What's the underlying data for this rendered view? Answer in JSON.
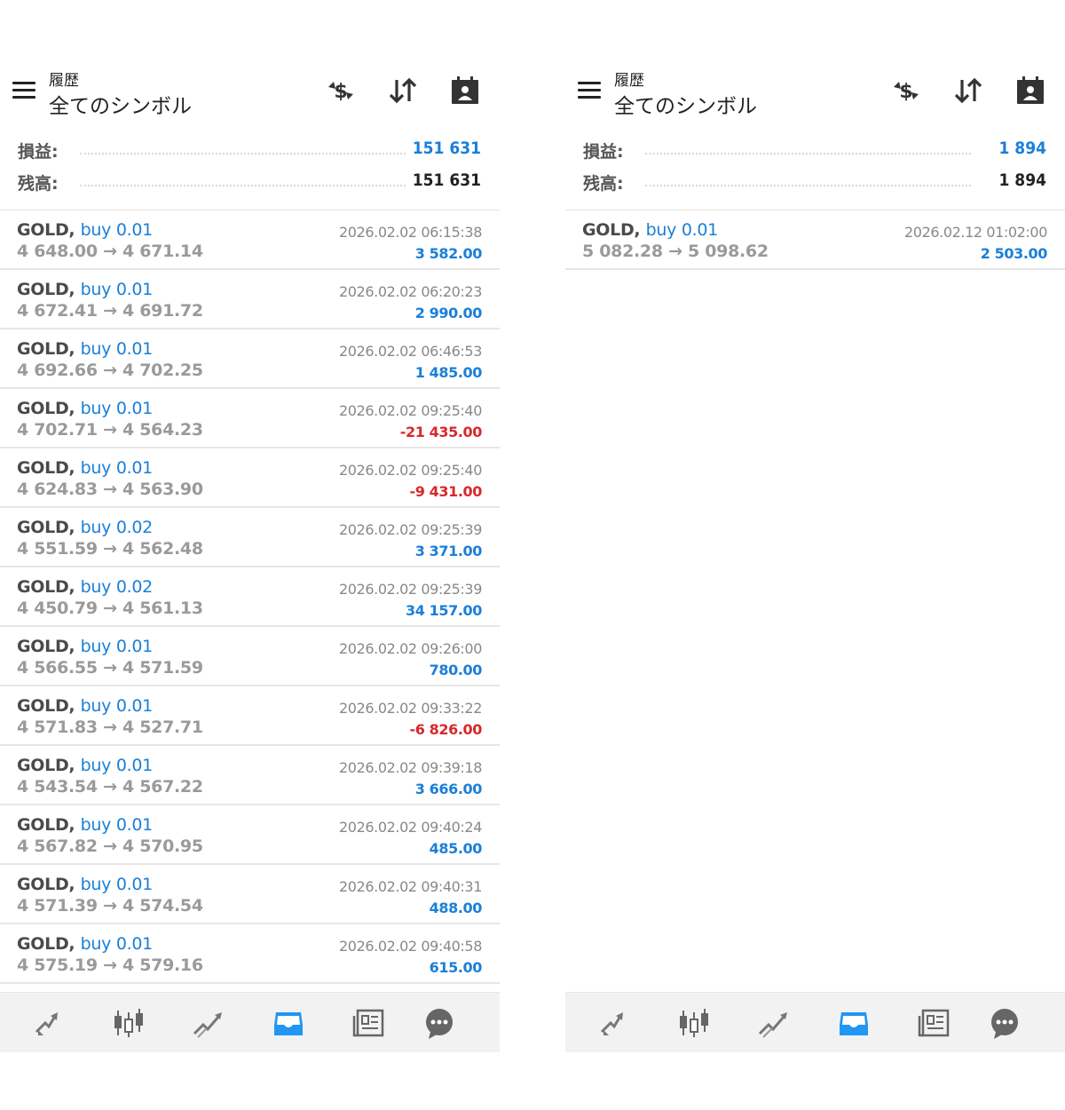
{
  "colors": {
    "accent_blue": "#1a7fd8",
    "loss_red": "#d8282b",
    "nav_bg": "#f2f2f2"
  },
  "icons": {
    "header": [
      "menu-icon",
      "currency-exchange-icon",
      "sort-icon",
      "calendar-icon"
    ],
    "nav": [
      "trade-icon",
      "candles-icon",
      "chart-icon",
      "history-inbox-icon",
      "news-icon",
      "chat-icon"
    ]
  },
  "left": {
    "header": {
      "small": "履歴",
      "title": "全てのシンボル"
    },
    "summary": {
      "profit_label": "損益:",
      "profit_value": "151 631",
      "balance_label": "残高:",
      "balance_value": "151 631"
    },
    "rows": [
      {
        "symbol": "GOLD,",
        "type": "buy 0.01",
        "prices": "4 648.00 → 4 671.14",
        "time": "2026.02.02 06:15:38",
        "profit": "3 582.00",
        "negative": false
      },
      {
        "symbol": "GOLD,",
        "type": "buy 0.01",
        "prices": "4 672.41 → 4 691.72",
        "time": "2026.02.02 06:20:23",
        "profit": "2 990.00",
        "negative": false
      },
      {
        "symbol": "GOLD,",
        "type": "buy 0.01",
        "prices": "4 692.66 → 4 702.25",
        "time": "2026.02.02 06:46:53",
        "profit": "1 485.00",
        "negative": false
      },
      {
        "symbol": "GOLD,",
        "type": "buy 0.01",
        "prices": "4 702.71 → 4 564.23",
        "time": "2026.02.02 09:25:40",
        "profit": "-21 435.00",
        "negative": true
      },
      {
        "symbol": "GOLD,",
        "type": "buy 0.01",
        "prices": "4 624.83 → 4 563.90",
        "time": "2026.02.02 09:25:40",
        "profit": "-9 431.00",
        "negative": true
      },
      {
        "symbol": "GOLD,",
        "type": "buy 0.02",
        "prices": "4 551.59 → 4 562.48",
        "time": "2026.02.02 09:25:39",
        "profit": "3 371.00",
        "negative": false
      },
      {
        "symbol": "GOLD,",
        "type": "buy 0.02",
        "prices": "4 450.79 → 4 561.13",
        "time": "2026.02.02 09:25:39",
        "profit": "34 157.00",
        "negative": false
      },
      {
        "symbol": "GOLD,",
        "type": "buy 0.01",
        "prices": "4 566.55 → 4 571.59",
        "time": "2026.02.02 09:26:00",
        "profit": "780.00",
        "negative": false
      },
      {
        "symbol": "GOLD,",
        "type": "buy 0.01",
        "prices": "4 571.83 → 4 527.71",
        "time": "2026.02.02 09:33:22",
        "profit": "-6 826.00",
        "negative": true
      },
      {
        "symbol": "GOLD,",
        "type": "buy 0.01",
        "prices": "4 543.54 → 4 567.22",
        "time": "2026.02.02 09:39:18",
        "profit": "3 666.00",
        "negative": false
      },
      {
        "symbol": "GOLD,",
        "type": "buy 0.01",
        "prices": "4 567.82 → 4 570.95",
        "time": "2026.02.02 09:40:24",
        "profit": "485.00",
        "negative": false
      },
      {
        "symbol": "GOLD,",
        "type": "buy 0.01",
        "prices": "4 571.39 → 4 574.54",
        "time": "2026.02.02 09:40:31",
        "profit": "488.00",
        "negative": false
      },
      {
        "symbol": "GOLD,",
        "type": "buy 0.01",
        "prices": "4 575.19 → 4 579.16",
        "time": "2026.02.02 09:40:58",
        "profit": "615.00",
        "negative": false
      }
    ]
  },
  "right": {
    "header": {
      "small": "履歴",
      "title": "全てのシンボル"
    },
    "summary": {
      "profit_label": "損益:",
      "profit_value": "1 894",
      "balance_label": "残高:",
      "balance_value": "1 894"
    },
    "rows": [
      {
        "symbol": "GOLD,",
        "type": "buy 0.01",
        "prices": "5 082.28 → 5 098.62",
        "time": "2026.02.12 01:02:00",
        "profit": "2 503.00",
        "negative": false
      }
    ]
  }
}
